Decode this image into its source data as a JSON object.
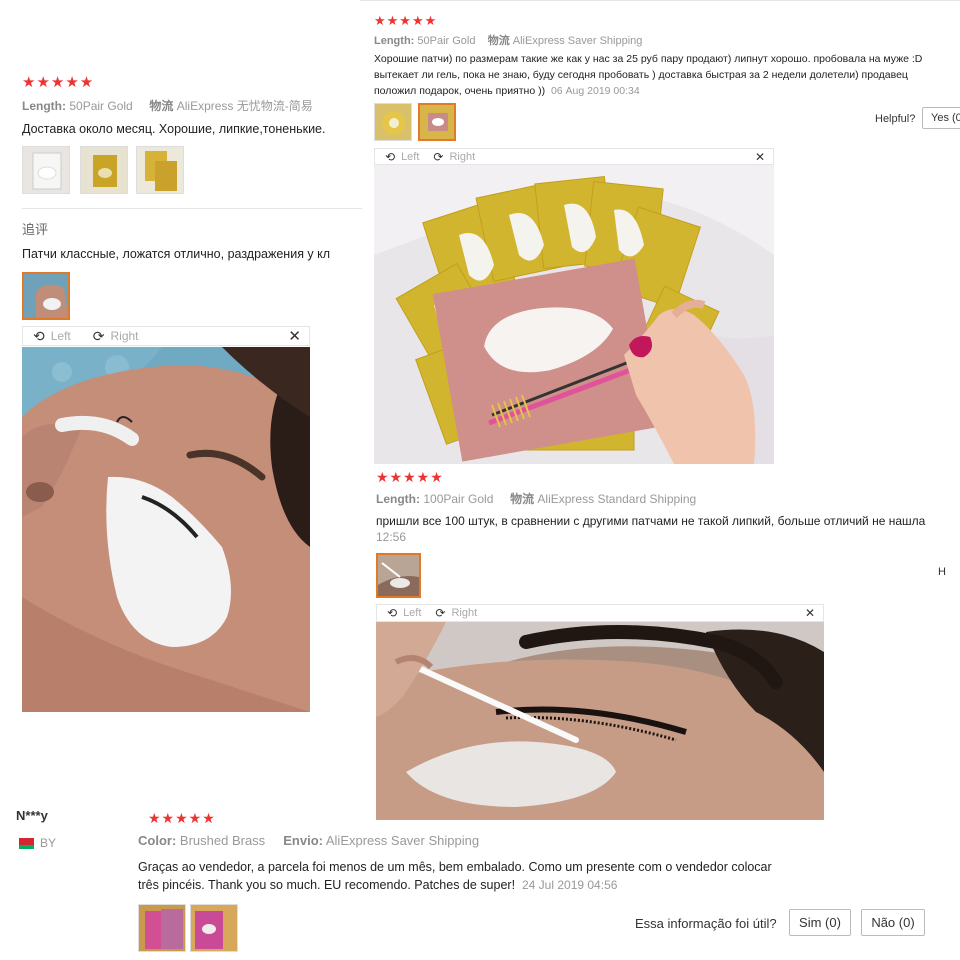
{
  "review1": {
    "stars": "★★★★★",
    "length_label": "Length:",
    "length_value": "50Pair Gold",
    "ship_label": "物流",
    "ship_value": "AliExpress 无忧物流-简易",
    "text": "Доставка около месяц. Хорошие, липкие,тоненькие.",
    "followup_label": "追评",
    "followup_text": "Патчи классные, ложатся отлично, раздражения у кл",
    "viewer": {
      "left": "Left",
      "right": "Right",
      "close": "✕"
    }
  },
  "review2": {
    "stars": "★★★★★",
    "length_label": "Length:",
    "length_value": "50Pair Gold",
    "ship_label": "物流",
    "ship_value": "AliExpress Saver Shipping",
    "text_line1": "Хорошие патчи) по размерам такие же как у нас за 25 руб пару продают) липнут хорошо. пробовала на муже :D",
    "text_line2": "вытекает ли гель, пока не знаю, буду сегодня пробовать ) доставка быстрая за 2 недели долетели) продавец",
    "text_line3": "положил подарок, очень приятно ))",
    "date": "06 Aug 2019 00:34",
    "helpful_label": "Helpful?",
    "yes_label": "Yes (0",
    "viewer": {
      "left": "Left",
      "right": "Right",
      "close": "✕"
    }
  },
  "review3": {
    "stars": "★★★★★",
    "length_label": "Length:",
    "length_value": "100Pair Gold",
    "ship_label": "物流",
    "ship_value": "AliExpress Standard Shipping",
    "text": "пришли все 100 штук, в сравнении с другими патчами не такой липкий, больше отличий не нашла",
    "date": "12:56",
    "helpful_cut": "H",
    "viewer": {
      "left": "Left",
      "right": "Right",
      "close": "✕"
    }
  },
  "review4": {
    "author": "N***y",
    "country": "BY",
    "stars": "★★★★★",
    "color_label": "Color:",
    "color_value": "Brushed Brass",
    "ship_label": "Envio:",
    "ship_value": "AliExpress Saver Shipping",
    "text_line1": "Graças ao vendedor, a parcela foi menos de um mês, bem embalado. Como um presente com o vendedor colocar",
    "text_line2": "três pincéis. Thank you so much. EU recomendo. Patches de super!",
    "date": "24 Jul 2019 04:56",
    "helpful_label": "Essa informação foi útil?",
    "yes_label": "Sim (0)",
    "no_label": "Não (0)"
  },
  "colors": {
    "star": "#ee3333",
    "selected_border": "#e07a28",
    "muted": "#999999"
  },
  "icons": {
    "rotate_left": "rotate-left-icon",
    "rotate_right": "rotate-right-icon",
    "close": "close-icon",
    "flag": "belarus-flag-icon"
  }
}
